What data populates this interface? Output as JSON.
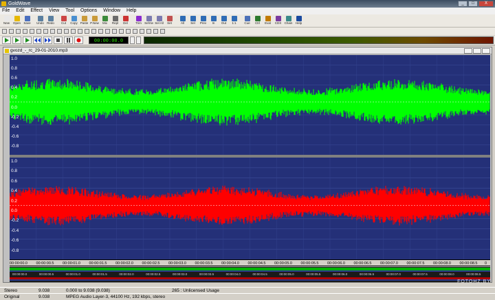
{
  "window": {
    "title": "GoldWave",
    "icon": "goldwave-icon",
    "btn_min": "_",
    "btn_max": "□",
    "btn_close": "X"
  },
  "menu": [
    "File",
    "Edit",
    "Effect",
    "View",
    "Tool",
    "Options",
    "Window",
    "Help"
  ],
  "toolbar": [
    {
      "label": "New",
      "icon": "new-file-icon"
    },
    {
      "label": "Open",
      "icon": "open-folder-icon"
    },
    {
      "label": "Save",
      "icon": "save-icon"
    },
    {
      "label": "Undo",
      "icon": "undo-icon"
    },
    {
      "label": "Redo",
      "icon": "redo-icon"
    },
    {
      "label": "Cut",
      "icon": "scissors-icon"
    },
    {
      "label": "Copy",
      "icon": "copy-icon"
    },
    {
      "label": "Paste",
      "icon": "paste-icon"
    },
    {
      "label": "P.New",
      "icon": "paste-new-icon"
    },
    {
      "label": "Mix",
      "icon": "mix-icon"
    },
    {
      "label": "Repl",
      "icon": "replace-icon"
    },
    {
      "label": "Del",
      "icon": "delete-icon"
    },
    {
      "label": "Trim",
      "icon": "trim-icon"
    },
    {
      "label": "SelVw",
      "icon": "select-view-icon"
    },
    {
      "label": "Sel All",
      "icon": "select-all-icon"
    },
    {
      "label": "Set",
      "icon": "set-icon"
    },
    {
      "label": "All",
      "icon": "zoom-all-icon"
    },
    {
      "label": "Sel",
      "icon": "zoom-sel-icon"
    },
    {
      "label": "Prev",
      "icon": "zoom-prev-icon"
    },
    {
      "label": "In",
      "icon": "zoom-in-icon"
    },
    {
      "label": "Out",
      "icon": "zoom-out-icon"
    },
    {
      "label": "1:1",
      "icon": "zoom-one-icon"
    },
    {
      "label": "Cue",
      "icon": "cue-icon"
    },
    {
      "label": "Ctrl",
      "icon": "control-icon"
    },
    {
      "label": "Eval",
      "icon": "evaluate-icon"
    },
    {
      "label": "CDX",
      "icon": "cd-icon"
    },
    {
      "label": "Chain",
      "icon": "chain-icon"
    },
    {
      "label": "Help",
      "icon": "help-icon"
    }
  ],
  "transport": {
    "time": "00:00:00.0"
  },
  "document": {
    "title": "gvozd_-_rc_29-01-2010.mp3"
  },
  "axis_labels": [
    "1.0",
    "0.8",
    "0.6",
    "0.4",
    "0.2",
    "0.0",
    "-0.2",
    "-0.4",
    "-0.6",
    "-0.8"
  ],
  "timeline": [
    "00:00:00.0",
    "00:00:00.5",
    "00:00:01.0",
    "00:00:01.5",
    "00:00:02.0",
    "00:00:02.5",
    "00:00:03.0",
    "00:00:03.5",
    "00:00:04.0",
    "00:00:04.5",
    "00:00:05.0",
    "00:00:05.5",
    "00:00:06.0",
    "00:00:06.5",
    "00:00:07.0",
    "00:00:07.5",
    "00:00:08.0",
    "00:00:08.5",
    "0"
  ],
  "overview_timeline": [
    "00:00:00.0",
    "00:00:00.5",
    "00:00:01.0",
    "00:00:01.5",
    "00:00:02.0",
    "00:00:02.5",
    "00:00:03.0",
    "00:00:03.5",
    "00:00:04.0",
    "00:00:04.5",
    "00:00:05.0",
    "00:00:05.5",
    "00:00:06.0",
    "00:00:06.5",
    "00:00:07.0",
    "00:00:07.5",
    "00:00:08.0",
    "00:00:08.5"
  ],
  "status": {
    "row1": {
      "channels": "Stereo",
      "length": "9.038",
      "selection": "0.000 to 9.038 (9.038)",
      "license": "265 : Unlicensed Usage"
    },
    "row2": {
      "label": "Original",
      "length": "9.038",
      "format": "MPEG Audio Layer-3, 44100 Hz, 192 kbps, stereo"
    }
  },
  "colors": {
    "background": "#243078",
    "left_channel": "#00ff00",
    "right_channel": "#ff0000"
  },
  "watermark": "FOTOHZ.BY"
}
